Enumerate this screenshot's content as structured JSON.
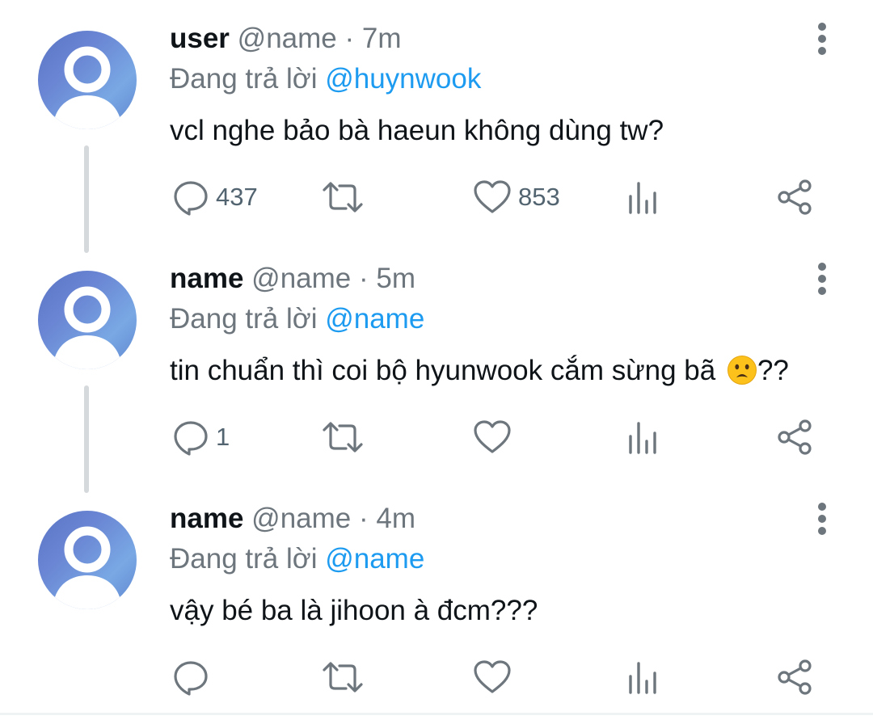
{
  "tweets": [
    {
      "display_name": "user",
      "handle": "@name",
      "dot": "·",
      "time": "7m",
      "replying_prefix": "Đang trả lời",
      "replying_to": "@huynwook",
      "text": "vcl nghe bảo bà haeun không dùng tw?",
      "emoji": null,
      "text_suffix": "",
      "reply_count": "437",
      "retweet_count": "",
      "like_count": "853"
    },
    {
      "display_name": "name",
      "handle": "@name",
      "dot": "·",
      "time": "5m",
      "replying_prefix": "Đang trả lời",
      "replying_to": "@name",
      "text": "tin chuẩn thì coi bộ hyunwook cắm sừng bã ",
      "emoji": "frowning-face-open-mouth",
      "text_suffix": "??",
      "reply_count": "1",
      "retweet_count": "",
      "like_count": ""
    },
    {
      "display_name": "name",
      "handle": "@name",
      "dot": "·",
      "time": "4m",
      "replying_prefix": "Đang trả lời",
      "replying_to": "@name",
      "text": "vậy bé ba là jihoon à đcm???",
      "emoji": null,
      "text_suffix": "",
      "reply_count": "",
      "retweet_count": "",
      "like_count": ""
    }
  ],
  "icons": {
    "avatar": "default-avatar-icon",
    "more": "more-vertical-icon",
    "reply": "reply-bubble-icon",
    "retweet": "retweet-icon",
    "like": "heart-icon",
    "views": "views-bar-chart-icon",
    "share": "share-icon"
  },
  "colors": {
    "text_primary": "#0f1419",
    "text_secondary": "#6e767d",
    "mention": "#1d9bf0",
    "thread_line": "#d6d9dc",
    "avatar_blue": "#6a86d4"
  }
}
